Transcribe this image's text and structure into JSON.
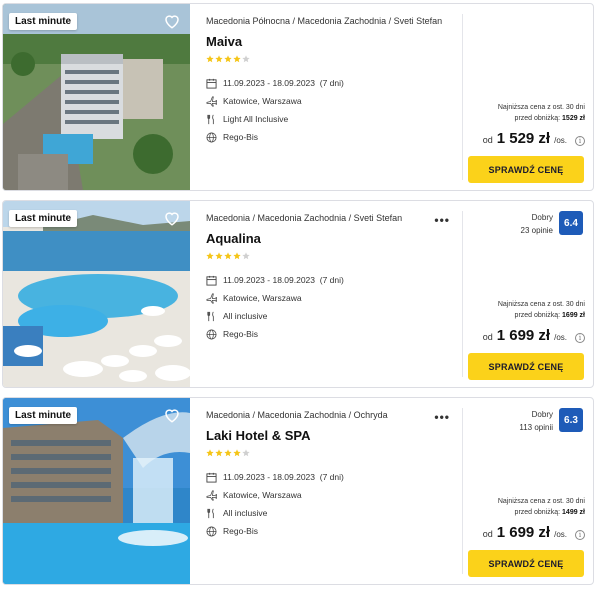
{
  "colors": {
    "badge_bg": "#ffffff",
    "cta_bg": "#fbd21a",
    "rating_bg": "#1e5bb8",
    "star_filled": "#f5c518",
    "star_empty": "#d0d0d0"
  },
  "offers": [
    {
      "badge": "Last minute",
      "location": "Macedonia Północna / Macedonia Zachodnia / Sveti Stefan",
      "name": "Maiva",
      "stars_filled": 4,
      "stars_total": 5,
      "dates": "11.09.2023 - 18.09.2023",
      "nights": "(7 dni)",
      "departure": "Katowice, Warszawa",
      "board": "Light All Inclusive",
      "operator": "Rego-Bis",
      "rating_label": "",
      "rating_count": "",
      "rating_score": "",
      "lowest_line1": "Najniższa cena z ost. 30 dni",
      "lowest_line2_prefix": "przed obniżką: ",
      "lowest_value": "1529 zł",
      "price_from": "od",
      "price": "1 529 zł",
      "price_per": "/os.",
      "cta": "SPRAWDŹ CENĘ",
      "menu": "",
      "photo": "hotel-building-aerial"
    },
    {
      "badge": "Last minute",
      "location": "Macedonia / Macedonia Zachodnia / Sveti Stefan",
      "name": "Aqualina",
      "stars_filled": 4,
      "stars_total": 5,
      "dates": "11.09.2023 - 18.09.2023",
      "nights": "(7 dni)",
      "departure": "Katowice, Warszawa",
      "board": "All inclusive",
      "operator": "Rego-Bis",
      "rating_label": "Dobry",
      "rating_count": "23 opinie",
      "rating_score": "6.4",
      "lowest_line1": "Najniższa cena z ost. 30 dni",
      "lowest_line2_prefix": "przed obniżką: ",
      "lowest_value": "1699 zł",
      "price_from": "od",
      "price": "1 699 zł",
      "price_per": "/os.",
      "cta": "SPRAWDŹ CENĘ",
      "menu": "•••",
      "photo": "pool-with-umbrellas"
    },
    {
      "badge": "Last minute",
      "location": "Macedonia / Macedonia Zachodnia / Ochryda",
      "name": "Laki Hotel & SPA",
      "stars_filled": 4,
      "stars_total": 5,
      "dates": "11.09.2023 - 18.09.2023",
      "nights": "(7 dni)",
      "departure": "Katowice, Warszawa",
      "board": "All inclusive",
      "operator": "Rego-Bis",
      "rating_label": "Dobry",
      "rating_count": "113 opinii",
      "rating_score": "6.3",
      "lowest_line1": "Najniższa cena z ost. 30 dni",
      "lowest_line2_prefix": "przed obniżką: ",
      "lowest_value": "1499 zł",
      "price_from": "od",
      "price": "1 699 zł",
      "price_per": "/os.",
      "cta": "SPRAWDŹ CENĘ",
      "menu": "•••",
      "photo": "hotel-pool-waterfall"
    }
  ]
}
